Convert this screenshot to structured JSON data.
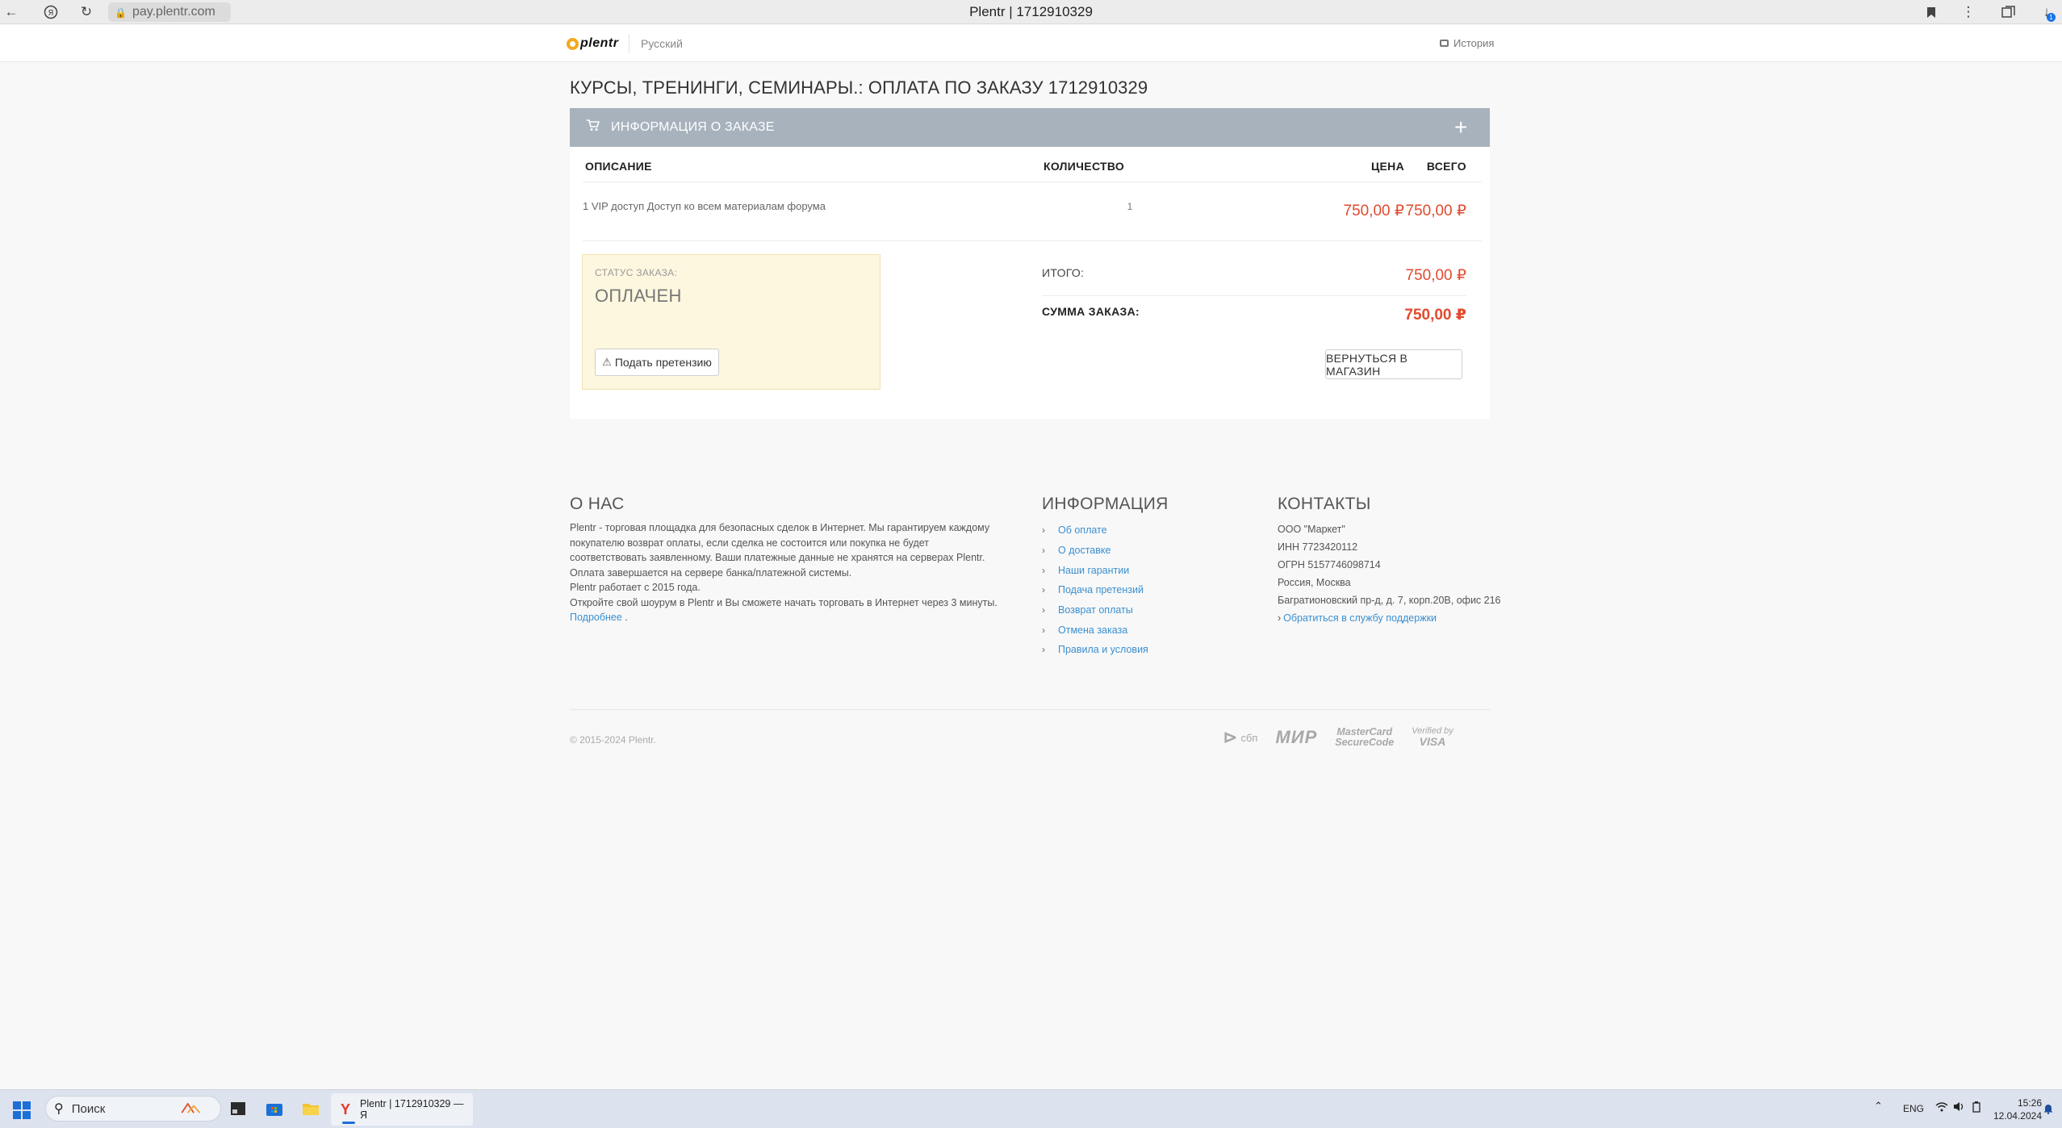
{
  "browser": {
    "url": "pay.plentr.com",
    "tab_title": "Plentr | 1712910329",
    "downloads_badge": "1"
  },
  "header": {
    "logo": "plentr",
    "language": "Русский",
    "history": "История"
  },
  "page": {
    "title": "КУРСЫ, ТРЕНИНГИ, СЕМИНАРЫ.: ОПЛАТА ПО ЗАКАЗУ 1712910329"
  },
  "order": {
    "panel_title": "ИНФОРМАЦИЯ О ЗАКАЗЕ",
    "columns": {
      "description": "ОПИСАНИЕ",
      "quantity": "КОЛИЧЕСТВО",
      "price": "ЦЕНА",
      "total": "ВСЕГО"
    },
    "items": [
      {
        "description": "1 VIP доступ Доступ ко всем материалам форума",
        "quantity": "1",
        "price": "750,00 ₽",
        "total": "750,00 ₽"
      }
    ],
    "status_label": "СТАТУС ЗАКАЗА:",
    "status_value": "ОПЛАЧЕН",
    "claim_button": "Подать претензию",
    "subtotal_label": "ИТОГО:",
    "subtotal_value": "750,00 ₽",
    "sum_label": "СУММА ЗАКАЗА:",
    "sum_value": "750,00 ₽",
    "return_button": "ВЕРНУТЬСЯ В МАГАЗИН"
  },
  "footer": {
    "about": {
      "title": "О НАС",
      "p1": "Plentr - торговая площадка для безопасных сделок в Интернет. Мы гарантируем каждому покупателю возврат оплаты, если сделка не состоится или покупка не будет соответствовать заявленному. Ваши платежные данные не хранятся на серверах Plentr. Оплата завершается на сервере банка/платежной системы.",
      "p2": "Plentr работает с 2015 года.",
      "p3": "Откройте свой шоурум в Plentr и Вы сможете начать торговать в Интернет через 3 минуты.",
      "more_link": "Подробнее",
      "more_dot": " ."
    },
    "info": {
      "title": "ИНФОРМАЦИЯ",
      "links": [
        "Об оплате",
        "О доставке",
        "Наши гарантии",
        "Подача претензий",
        "Возврат оплаты",
        "Отмена заказа",
        "Правила и условия"
      ]
    },
    "contacts": {
      "title": "КОНТАКТЫ",
      "company": "ООО \"Маркет\"",
      "inn": "ИНН 7723420112",
      "ogrn": "ОГРН 5157746098714",
      "city": "Россия, Москва",
      "address": "Багратионовский пр-д, д. 7, корп.20В, офис 216",
      "support_link": "Обратиться в службу поддержки"
    },
    "copyright": "© 2015-2024 Plentr.",
    "payment_logos": {
      "sbp": "сбп",
      "mir": "МИР",
      "mastercard_line1": "MasterCard",
      "mastercard_line2": "SecureCode",
      "visa_line1": "Verified by",
      "visa_line2": "VISA"
    }
  },
  "taskbar": {
    "search_placeholder": "Поиск",
    "browser_tab": "Plentr | 1712910329 — Я",
    "language": "ENG",
    "time": "15:26",
    "date": "12.04.2024"
  },
  "colors": {
    "accent_price": "#e14a2e",
    "panel_header": "#a7b2bd",
    "link": "#3a8fd0",
    "status_bg": "#fdf7df"
  }
}
